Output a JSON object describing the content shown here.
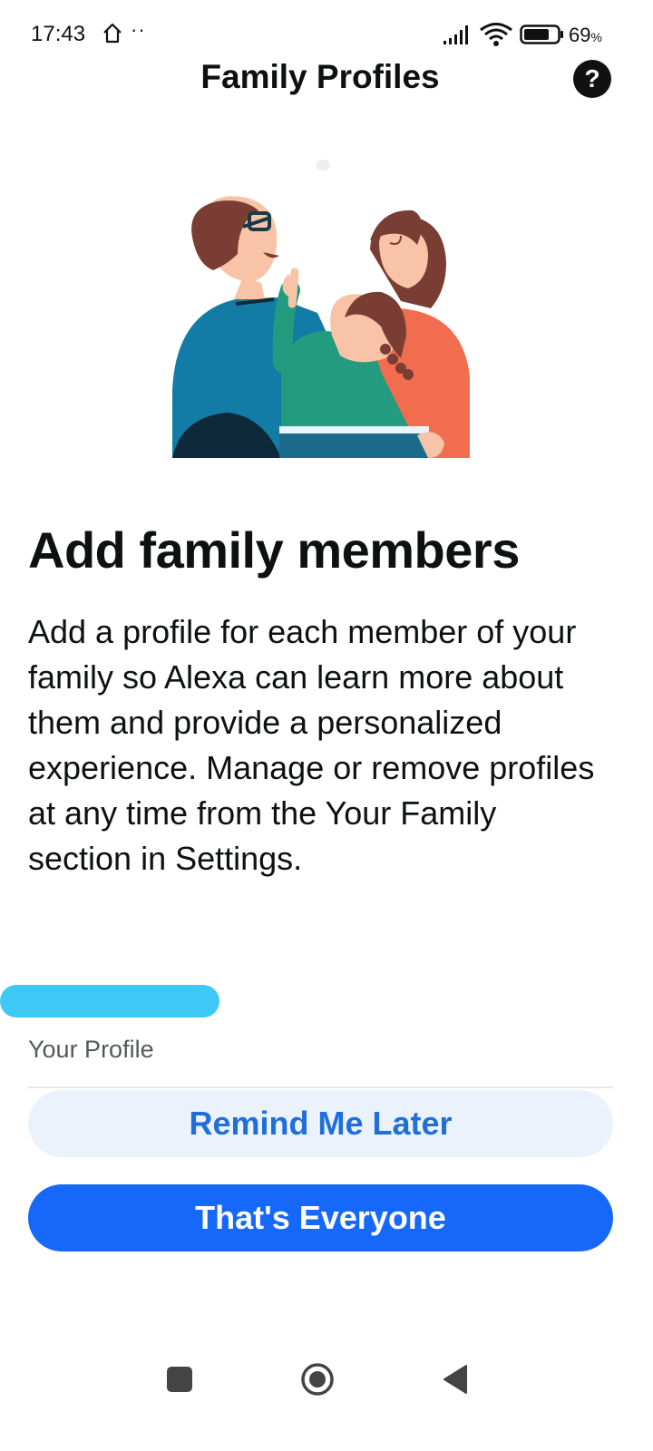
{
  "status_bar": {
    "time": "17:43",
    "dots": "··",
    "battery_percent": "69",
    "battery_unit": "%"
  },
  "header": {
    "title": "Family Profiles",
    "help_label": "?"
  },
  "main": {
    "headline": "Add family members",
    "description": "Add a profile for each member of your family so Alexa can learn more about them and provide a personalized experience. Manage or remove profiles at any time from the Your Family section in Settings."
  },
  "profile": {
    "label": "Your Profile"
  },
  "actions": {
    "remind_label": "Remind Me Later",
    "everyone_label": "That's Everyone"
  },
  "colors": {
    "primary_button": "#1668fb",
    "secondary_button": "#ebf2fb",
    "secondary_text": "#1f6fdb",
    "redaction": "#3dc8f6"
  },
  "icons": {
    "status": [
      "home-outline-icon",
      "signal-icon",
      "wifi-icon",
      "battery-icon"
    ],
    "nav": [
      "recent-apps-icon",
      "home-icon",
      "back-icon"
    ]
  }
}
